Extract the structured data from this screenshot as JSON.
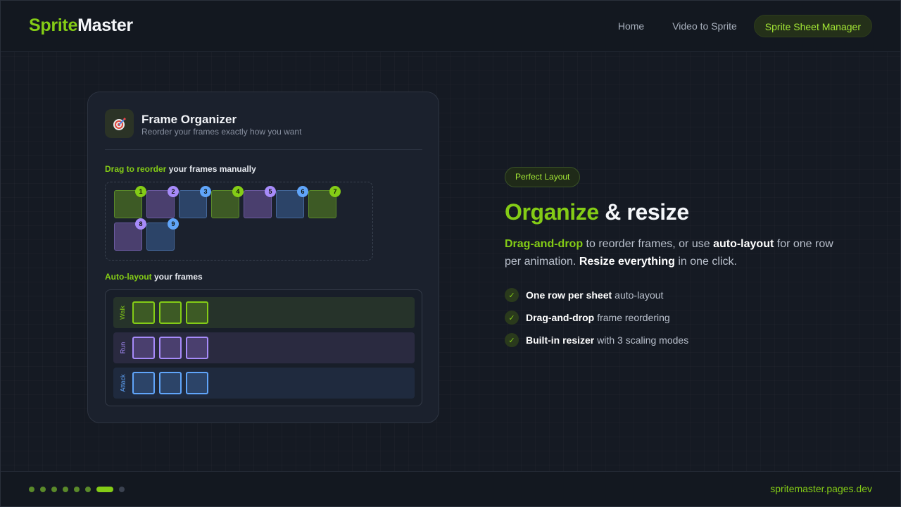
{
  "header": {
    "brand_a": "Sprite",
    "brand_b": "Master",
    "nav": [
      "Home",
      "Video to Sprite",
      "Sprite Sheet Manager"
    ],
    "active_nav": "Sprite Sheet Manager"
  },
  "card": {
    "icon": "target-icon",
    "title": "Frame Organizer",
    "subtitle": "Reorder your frames exactly how you want",
    "drag_label_accent": "Drag to reorder",
    "drag_label_rest": " your frames manually",
    "frames": [
      {
        "n": "1",
        "color": "green"
      },
      {
        "n": "2",
        "color": "purple"
      },
      {
        "n": "3",
        "color": "blue"
      },
      {
        "n": "4",
        "color": "green"
      },
      {
        "n": "5",
        "color": "purple"
      },
      {
        "n": "6",
        "color": "blue"
      },
      {
        "n": "7",
        "color": "green"
      },
      {
        "n": "8",
        "color": "purple"
      },
      {
        "n": "9",
        "color": "blue"
      }
    ],
    "auto_label_accent": "Auto-layout",
    "auto_label_rest": " your frames",
    "rows": [
      {
        "label": "Walk",
        "color": "green",
        "count": 3
      },
      {
        "label": "Run",
        "color": "purple",
        "count": 3
      },
      {
        "label": "Attack",
        "color": "blue",
        "count": 3
      }
    ]
  },
  "info": {
    "pill": "Perfect Layout",
    "headline_accent": "Organize",
    "headline_rest": " & resize",
    "p_1": "Drag-and-drop",
    "p_2": " to reorder frames, or use ",
    "p_3": "auto-layout",
    "p_4": " for one row per animation. ",
    "p_5": "Resize everything",
    "p_6": " in one click.",
    "features": [
      {
        "bold": "One row per sheet",
        "rest": "auto-layout"
      },
      {
        "bold": "Drag-and-drop",
        "rest": "frame reordering"
      },
      {
        "bold": "Built-in resizer",
        "rest": "with 3 scaling modes"
      }
    ],
    "check": "✓"
  },
  "footer": {
    "slides_total": 8,
    "slide_active": 7,
    "site": "spritemaster.pages.dev"
  }
}
